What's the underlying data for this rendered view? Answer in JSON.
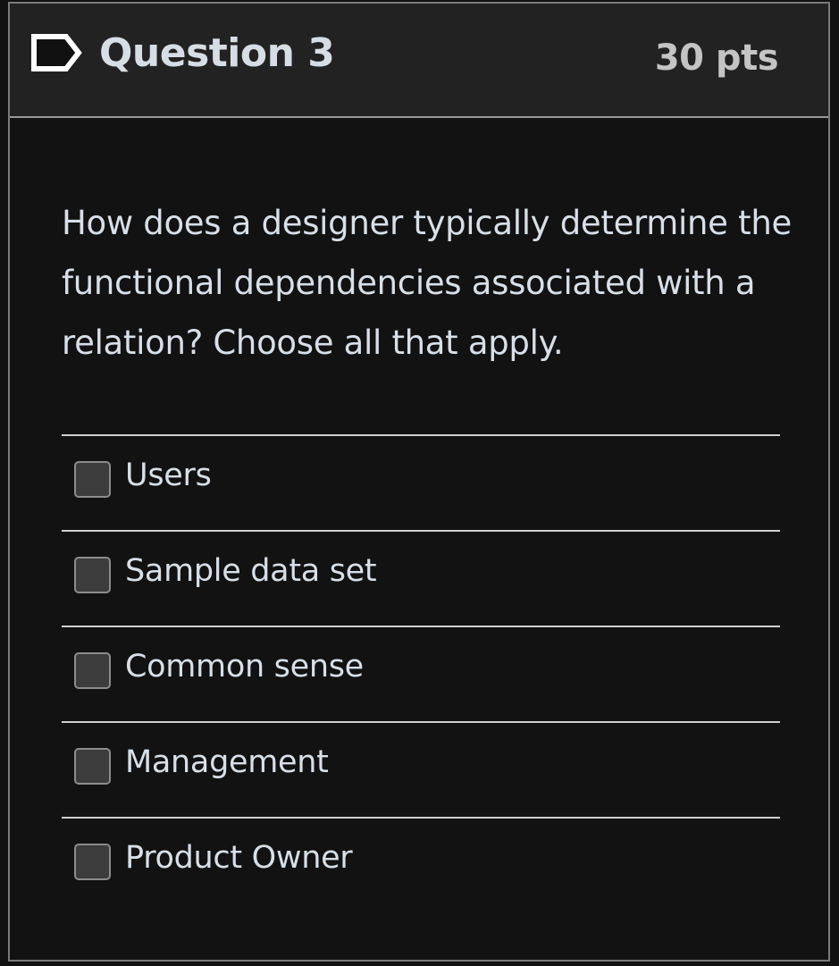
{
  "question": {
    "title": "Question 3",
    "points": "30 pts",
    "text": "How does a designer typically determine the functional dependencies associated with a relation? Choose all that apply.",
    "flag_icon": "flag-icon"
  },
  "answers": [
    {
      "label": "Users",
      "checked": false
    },
    {
      "label": "Sample data set",
      "checked": false
    },
    {
      "label": "Common sense",
      "checked": false
    },
    {
      "label": "Management",
      "checked": false
    },
    {
      "label": "Product Owner",
      "checked": false
    }
  ],
  "colors": {
    "background": "#111111",
    "header": "#222222",
    "text": "#d7dfe8",
    "checkbox_fill": "#3c3c3c"
  }
}
